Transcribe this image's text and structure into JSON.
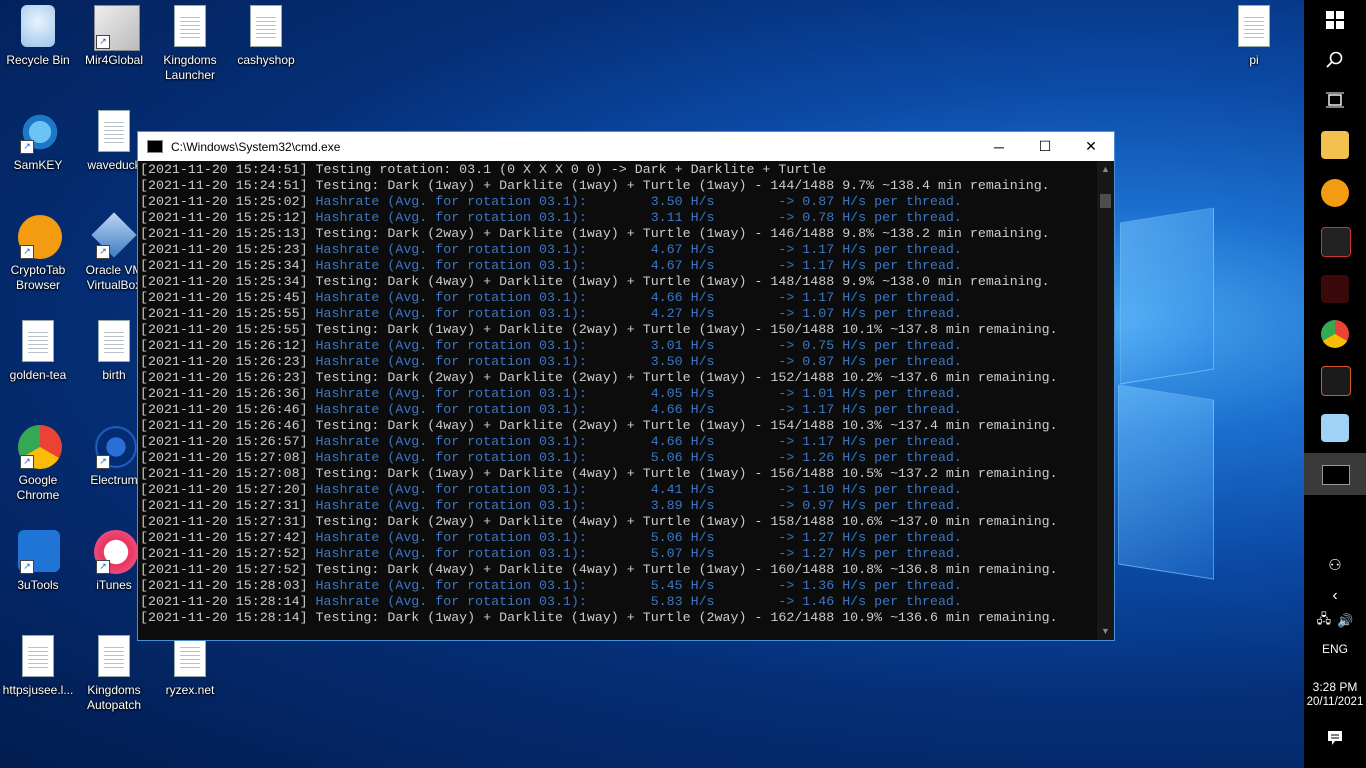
{
  "desktop": {
    "icons": [
      {
        "label": "Recycle Bin",
        "icon": "recycle-bin-icon"
      },
      {
        "label": "Mir4Global",
        "icon": "mir4-icon"
      },
      {
        "label": "Kingdoms Launcher",
        "icon": "document-icon"
      },
      {
        "label": "cashyshop",
        "icon": "document-icon"
      },
      {
        "label": "pi",
        "icon": "document-icon"
      },
      {
        "label": "SamKEY",
        "icon": "key-icon"
      },
      {
        "label": "waveduck",
        "icon": "document-icon"
      },
      {
        "label": "CryptoTab Browser",
        "icon": "cryptotab-icon"
      },
      {
        "label": "Oracle VM VirtualBox",
        "icon": "virtualbox-icon"
      },
      {
        "label": "golden-tea",
        "icon": "document-icon"
      },
      {
        "label": "birth",
        "icon": "document-icon"
      },
      {
        "label": "Google Chrome",
        "icon": "chrome-icon"
      },
      {
        "label": "Electrum",
        "icon": "electrum-icon"
      },
      {
        "label": "3uTools",
        "icon": "3utools-icon"
      },
      {
        "label": "iTunes",
        "icon": "itunes-icon"
      },
      {
        "label": "httpsjusee.l...",
        "icon": "document-icon"
      },
      {
        "label": "Kingdoms Autopatch",
        "icon": "document-icon"
      },
      {
        "label": "ryzex.net",
        "icon": "document-icon"
      }
    ]
  },
  "window": {
    "title": "C:\\Windows\\System32\\cmd.exe",
    "minimize": "─",
    "maximize": "☐",
    "close": "✕"
  },
  "console": {
    "lines": [
      {
        "kind": "test",
        "ts": "[2021-11-20 15:24:51]",
        "text": " Testing rotation: 03.1 (0 X X X 0 0) -> Dark + Darklite + Turtle"
      },
      {
        "kind": "test",
        "ts": "[2021-11-20 15:24:51]",
        "text": " Testing: Dark (1way) + Darklite (1way) + Turtle (1way) - 144/1488 9.7% ~138.4 min remaining."
      },
      {
        "kind": "hash",
        "ts": "[2021-11-20 15:25:02]",
        "text": " Hashrate (Avg. for rotation 03.1):        3.50 H/s        -> 0.87 H/s per thread."
      },
      {
        "kind": "hash",
        "ts": "[2021-11-20 15:25:12]",
        "text": " Hashrate (Avg. for rotation 03.1):        3.11 H/s        -> 0.78 H/s per thread."
      },
      {
        "kind": "test",
        "ts": "[2021-11-20 15:25:13]",
        "text": " Testing: Dark (2way) + Darklite (1way) + Turtle (1way) - 146/1488 9.8% ~138.2 min remaining."
      },
      {
        "kind": "hash",
        "ts": "[2021-11-20 15:25:23]",
        "text": " Hashrate (Avg. for rotation 03.1):        4.67 H/s        -> 1.17 H/s per thread."
      },
      {
        "kind": "hash",
        "ts": "[2021-11-20 15:25:34]",
        "text": " Hashrate (Avg. for rotation 03.1):        4.67 H/s        -> 1.17 H/s per thread."
      },
      {
        "kind": "test",
        "ts": "[2021-11-20 15:25:34]",
        "text": " Testing: Dark (4way) + Darklite (1way) + Turtle (1way) - 148/1488 9.9% ~138.0 min remaining."
      },
      {
        "kind": "hash",
        "ts": "[2021-11-20 15:25:45]",
        "text": " Hashrate (Avg. for rotation 03.1):        4.66 H/s        -> 1.17 H/s per thread."
      },
      {
        "kind": "hash",
        "ts": "[2021-11-20 15:25:55]",
        "text": " Hashrate (Avg. for rotation 03.1):        4.27 H/s        -> 1.07 H/s per thread."
      },
      {
        "kind": "test",
        "ts": "[2021-11-20 15:25:55]",
        "text": " Testing: Dark (1way) + Darklite (2way) + Turtle (1way) - 150/1488 10.1% ~137.8 min remaining."
      },
      {
        "kind": "hash",
        "ts": "[2021-11-20 15:26:12]",
        "text": " Hashrate (Avg. for rotation 03.1):        3.01 H/s        -> 0.75 H/s per thread."
      },
      {
        "kind": "hash",
        "ts": "[2021-11-20 15:26:23]",
        "text": " Hashrate (Avg. for rotation 03.1):        3.50 H/s        -> 0.87 H/s per thread."
      },
      {
        "kind": "test",
        "ts": "[2021-11-20 15:26:23]",
        "text": " Testing: Dark (2way) + Darklite (2way) + Turtle (1way) - 152/1488 10.2% ~137.6 min remaining."
      },
      {
        "kind": "hash",
        "ts": "[2021-11-20 15:26:36]",
        "text": " Hashrate (Avg. for rotation 03.1):        4.05 H/s        -> 1.01 H/s per thread."
      },
      {
        "kind": "hash",
        "ts": "[2021-11-20 15:26:46]",
        "text": " Hashrate (Avg. for rotation 03.1):        4.66 H/s        -> 1.17 H/s per thread."
      },
      {
        "kind": "test",
        "ts": "[2021-11-20 15:26:46]",
        "text": " Testing: Dark (4way) + Darklite (2way) + Turtle (1way) - 154/1488 10.3% ~137.4 min remaining."
      },
      {
        "kind": "hash",
        "ts": "[2021-11-20 15:26:57]",
        "text": " Hashrate (Avg. for rotation 03.1):        4.66 H/s        -> 1.17 H/s per thread."
      },
      {
        "kind": "hash",
        "ts": "[2021-11-20 15:27:08]",
        "text": " Hashrate (Avg. for rotation 03.1):        5.06 H/s        -> 1.26 H/s per thread."
      },
      {
        "kind": "test",
        "ts": "[2021-11-20 15:27:08]",
        "text": " Testing: Dark (1way) + Darklite (4way) + Turtle (1way) - 156/1488 10.5% ~137.2 min remaining."
      },
      {
        "kind": "hash",
        "ts": "[2021-11-20 15:27:20]",
        "text": " Hashrate (Avg. for rotation 03.1):        4.41 H/s        -> 1.10 H/s per thread."
      },
      {
        "kind": "hash",
        "ts": "[2021-11-20 15:27:31]",
        "text": " Hashrate (Avg. for rotation 03.1):        3.89 H/s        -> 0.97 H/s per thread."
      },
      {
        "kind": "test",
        "ts": "[2021-11-20 15:27:31]",
        "text": " Testing: Dark (2way) + Darklite (4way) + Turtle (1way) - 158/1488 10.6% ~137.0 min remaining."
      },
      {
        "kind": "hash",
        "ts": "[2021-11-20 15:27:42]",
        "text": " Hashrate (Avg. for rotation 03.1):        5.06 H/s        -> 1.27 H/s per thread."
      },
      {
        "kind": "hash",
        "ts": "[2021-11-20 15:27:52]",
        "text": " Hashrate (Avg. for rotation 03.1):        5.07 H/s        -> 1.27 H/s per thread."
      },
      {
        "kind": "test",
        "ts": "[2021-11-20 15:27:52]",
        "text": " Testing: Dark (4way) + Darklite (4way) + Turtle (1way) - 160/1488 10.8% ~136.8 min remaining."
      },
      {
        "kind": "hash",
        "ts": "[2021-11-20 15:28:03]",
        "text": " Hashrate (Avg. for rotation 03.1):        5.45 H/s        -> 1.36 H/s per thread."
      },
      {
        "kind": "hash",
        "ts": "[2021-11-20 15:28:14]",
        "text": " Hashrate (Avg. for rotation 03.1):        5.83 H/s        -> 1.46 H/s per thread."
      },
      {
        "kind": "test",
        "ts": "[2021-11-20 15:28:14]",
        "text": " Testing: Dark (1way) + Darklite (1way) + Turtle (2way) - 162/1488 10.9% ~136.6 min remaining."
      }
    ]
  },
  "taskbar": {
    "language": "ENG",
    "time": "3:28 PM",
    "date": "20/11/2021",
    "colors": {
      "background": "#000000",
      "active": "#3a3a3a"
    }
  },
  "colors": {
    "console_text": "#cccccc",
    "hashrate_text": "#3b78c3",
    "console_bg": "#0c0c0c"
  }
}
